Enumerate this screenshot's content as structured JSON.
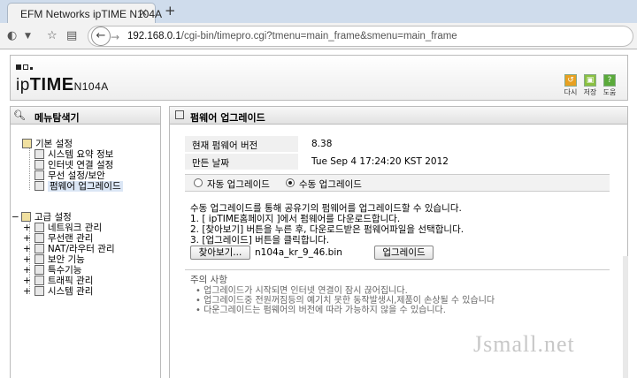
{
  "browser": {
    "tab_title": "EFM Networks ipTIME N104A",
    "tab_close": "×",
    "new_tab": "+",
    "url_host": "192.168.0.1",
    "url_path": "/cgi-bin/timepro.cgi?tmenu=main_frame&smenu=main_frame"
  },
  "header": {
    "logo_prefix": "ip",
    "logo_brand": "TIME",
    "logo_model": "N104A",
    "buttons": [
      {
        "label": "다시",
        "icon": "refresh-icon",
        "color": "#e8a020"
      },
      {
        "label": "저장",
        "icon": "save-icon",
        "color": "#8ac040"
      },
      {
        "label": "도움",
        "icon": "help-icon",
        "color": "#5aaa3a"
      }
    ]
  },
  "menu": {
    "title": "메뉴탐색기",
    "basic": {
      "label": "기본 설정",
      "items": [
        "시스템 요약 정보",
        "인터넷 연결 설정",
        "무선 설정/보안",
        "펌웨어 업그레이드"
      ]
    },
    "advanced": {
      "label": "고급 설정",
      "items": [
        "네트워크 관리",
        "무선랜 관리",
        "NAT/라우터 관리",
        "보안 기능",
        "특수기능",
        "트래픽 관리",
        "시스템 관리"
      ]
    }
  },
  "main": {
    "title": "펌웨어 업그레이드",
    "version_label": "현재 펌웨어 버전",
    "version_value": "8.38",
    "date_label": "만든 날짜",
    "date_value": "Tue Sep 4 17:24:20 KST 2012",
    "mode_auto": "자동 업그레이드",
    "mode_manual": "수동 업그레이드",
    "selected_mode": "manual",
    "desc": [
      "수동 업그레이드를 통해 공유기의 펌웨어를 업그레이드할 수 있습니다.",
      "1. [ ipTIME홈페이지 ]에서 펌웨어를 다운로드합니다.",
      "2. [찾아보기] 버튼을 누른 후, 다운로드받은 펌웨어파일을 선택합니다.",
      "3. [업그레이드] 버튼을 클릭합니다."
    ],
    "browse_button": "찾아보기...",
    "file_name": "n104a_kr_9_46.bin",
    "upgrade_button": "업그레이드",
    "notes_title": "주의 사항",
    "notes": [
      "업그레이드가 시작되면 인터넷 연결이 잠시 끊어집니다.",
      "업그레이드중 전원꺼짐등의 예기치 못한 동작발생시,제품이 손상될 수 있습니다",
      "다운그레이드는 펌웨어의 버전에 따라 가능하지 않을 수 있습니다."
    ]
  },
  "watermark": "Jsmall.net"
}
